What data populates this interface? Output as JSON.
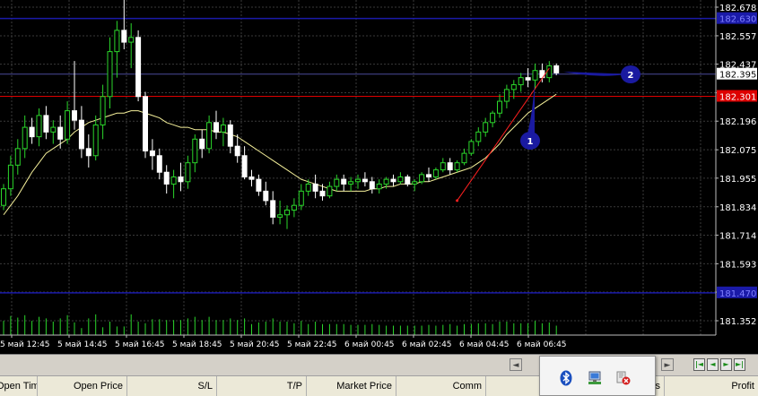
{
  "chart": {
    "price_axis": [
      "182.678",
      "182.557",
      "182.437",
      "182.316",
      "182.196",
      "182.075",
      "181.955",
      "181.834",
      "181.714",
      "181.593",
      "181.473",
      "181.352"
    ],
    "current_price": "182.395",
    "red_line_price": "182.301",
    "blue_top_price": "182.630",
    "blue_bottom_price": "181.470",
    "time_axis": [
      "5 май 12:45",
      "5 май 14:45",
      "5 май 16:45",
      "5 май 18:45",
      "5 май 20:45",
      "5 май 22:45",
      "6 май 00:45",
      "6 май 02:45",
      "6 май 04:45",
      "6 май 06:45"
    ],
    "callouts": [
      "1",
      "2"
    ],
    "colors": {
      "bull": "#2bd62b",
      "bear": "#ffffff",
      "ma": "#f5f09a",
      "grid": "#3a3a3a",
      "red_line": "#dd0000",
      "blue_line": "#1a1aa8",
      "trend_line": "#ff2020",
      "callout": "#1a1aa0"
    }
  },
  "chart_data": {
    "type": "candlestick",
    "title": "",
    "ylim": [
      181.3,
      182.74
    ],
    "candles": [
      {
        "o": 181.84,
        "h": 181.93,
        "l": 181.82,
        "c": 181.91
      },
      {
        "o": 181.91,
        "h": 182.05,
        "l": 181.88,
        "c": 182.01
      },
      {
        "o": 182.01,
        "h": 182.12,
        "l": 181.97,
        "c": 182.08
      },
      {
        "o": 182.08,
        "h": 182.22,
        "l": 182.04,
        "c": 182.17
      },
      {
        "o": 182.17,
        "h": 182.21,
        "l": 182.1,
        "c": 182.13
      },
      {
        "o": 182.13,
        "h": 182.25,
        "l": 182.09,
        "c": 182.22
      },
      {
        "o": 182.22,
        "h": 182.26,
        "l": 182.12,
        "c": 182.15
      },
      {
        "o": 182.15,
        "h": 182.2,
        "l": 182.1,
        "c": 182.17
      },
      {
        "o": 182.17,
        "h": 182.22,
        "l": 182.08,
        "c": 182.12
      },
      {
        "o": 182.12,
        "h": 182.28,
        "l": 182.1,
        "c": 182.24
      },
      {
        "o": 182.24,
        "h": 182.45,
        "l": 182.16,
        "c": 182.2
      },
      {
        "o": 182.2,
        "h": 182.26,
        "l": 182.04,
        "c": 182.08
      },
      {
        "o": 182.08,
        "h": 182.14,
        "l": 182.0,
        "c": 182.05
      },
      {
        "o": 182.05,
        "h": 182.22,
        "l": 182.03,
        "c": 182.18
      },
      {
        "o": 182.18,
        "h": 182.35,
        "l": 182.12,
        "c": 182.3
      },
      {
        "o": 182.3,
        "h": 182.55,
        "l": 182.25,
        "c": 182.49
      },
      {
        "o": 182.49,
        "h": 182.62,
        "l": 182.38,
        "c": 182.58
      },
      {
        "o": 182.58,
        "h": 182.74,
        "l": 182.5,
        "c": 182.53
      },
      {
        "o": 182.53,
        "h": 182.61,
        "l": 182.42,
        "c": 182.55
      },
      {
        "o": 182.55,
        "h": 182.58,
        "l": 182.28,
        "c": 182.3
      },
      {
        "o": 182.3,
        "h": 182.32,
        "l": 182.04,
        "c": 182.07
      },
      {
        "o": 182.07,
        "h": 182.12,
        "l": 181.99,
        "c": 182.05
      },
      {
        "o": 182.05,
        "h": 182.08,
        "l": 181.95,
        "c": 181.98
      },
      {
        "o": 181.98,
        "h": 182.01,
        "l": 181.89,
        "c": 181.93
      },
      {
        "o": 181.93,
        "h": 181.99,
        "l": 181.87,
        "c": 181.96
      },
      {
        "o": 181.96,
        "h": 182.02,
        "l": 181.9,
        "c": 181.94
      },
      {
        "o": 181.94,
        "h": 182.05,
        "l": 181.91,
        "c": 182.02
      },
      {
        "o": 182.02,
        "h": 182.14,
        "l": 181.98,
        "c": 182.12
      },
      {
        "o": 182.12,
        "h": 182.16,
        "l": 182.04,
        "c": 182.08
      },
      {
        "o": 182.08,
        "h": 182.22,
        "l": 182.06,
        "c": 182.19
      },
      {
        "o": 182.19,
        "h": 182.24,
        "l": 182.12,
        "c": 182.15
      },
      {
        "o": 182.15,
        "h": 182.21,
        "l": 182.09,
        "c": 182.18
      },
      {
        "o": 182.18,
        "h": 182.2,
        "l": 182.06,
        "c": 182.09
      },
      {
        "o": 182.09,
        "h": 182.14,
        "l": 182.02,
        "c": 182.05
      },
      {
        "o": 182.05,
        "h": 182.09,
        "l": 181.95,
        "c": 181.96
      },
      {
        "o": 181.96,
        "h": 181.99,
        "l": 181.92,
        "c": 181.95
      },
      {
        "o": 181.95,
        "h": 181.97,
        "l": 181.88,
        "c": 181.9
      },
      {
        "o": 181.9,
        "h": 181.94,
        "l": 181.84,
        "c": 181.86
      },
      {
        "o": 181.86,
        "h": 181.9,
        "l": 181.76,
        "c": 181.79
      },
      {
        "o": 181.79,
        "h": 181.86,
        "l": 181.76,
        "c": 181.8
      },
      {
        "o": 181.8,
        "h": 181.84,
        "l": 181.74,
        "c": 181.82
      },
      {
        "o": 181.82,
        "h": 181.87,
        "l": 181.79,
        "c": 181.84
      },
      {
        "o": 181.84,
        "h": 181.93,
        "l": 181.82,
        "c": 181.9
      },
      {
        "o": 181.9,
        "h": 181.95,
        "l": 181.88,
        "c": 181.93
      },
      {
        "o": 181.93,
        "h": 181.97,
        "l": 181.87,
        "c": 181.9
      },
      {
        "o": 181.9,
        "h": 181.93,
        "l": 181.86,
        "c": 181.88
      },
      {
        "o": 181.88,
        "h": 181.94,
        "l": 181.87,
        "c": 181.92
      },
      {
        "o": 181.92,
        "h": 181.97,
        "l": 181.9,
        "c": 181.95
      },
      {
        "o": 181.95,
        "h": 181.97,
        "l": 181.9,
        "c": 181.93
      },
      {
        "o": 181.93,
        "h": 181.96,
        "l": 181.9,
        "c": 181.94
      },
      {
        "o": 181.94,
        "h": 181.97,
        "l": 181.91,
        "c": 181.95
      },
      {
        "o": 181.95,
        "h": 181.98,
        "l": 181.92,
        "c": 181.94
      },
      {
        "o": 181.94,
        "h": 181.96,
        "l": 181.89,
        "c": 181.91
      },
      {
        "o": 181.91,
        "h": 181.95,
        "l": 181.89,
        "c": 181.93
      },
      {
        "o": 181.93,
        "h": 181.96,
        "l": 181.91,
        "c": 181.95
      },
      {
        "o": 181.95,
        "h": 181.97,
        "l": 181.92,
        "c": 181.94
      },
      {
        "o": 181.94,
        "h": 181.98,
        "l": 181.93,
        "c": 181.96
      },
      {
        "o": 181.96,
        "h": 181.97,
        "l": 181.92,
        "c": 181.93
      },
      {
        "o": 181.93,
        "h": 181.95,
        "l": 181.9,
        "c": 181.94
      },
      {
        "o": 181.94,
        "h": 181.98,
        "l": 181.93,
        "c": 181.97
      },
      {
        "o": 181.97,
        "h": 182.0,
        "l": 181.94,
        "c": 181.96
      },
      {
        "o": 181.96,
        "h": 182.0,
        "l": 181.95,
        "c": 181.99
      },
      {
        "o": 181.99,
        "h": 182.04,
        "l": 181.98,
        "c": 182.02
      },
      {
        "o": 182.02,
        "h": 182.04,
        "l": 181.97,
        "c": 181.99
      },
      {
        "o": 181.99,
        "h": 182.03,
        "l": 181.98,
        "c": 182.02
      },
      {
        "o": 182.02,
        "h": 182.08,
        "l": 182.01,
        "c": 182.06
      },
      {
        "o": 182.06,
        "h": 182.12,
        "l": 182.05,
        "c": 182.11
      },
      {
        "o": 182.11,
        "h": 182.17,
        "l": 182.09,
        "c": 182.15
      },
      {
        "o": 182.15,
        "h": 182.21,
        "l": 182.13,
        "c": 182.19
      },
      {
        "o": 182.19,
        "h": 182.24,
        "l": 182.17,
        "c": 182.23
      },
      {
        "o": 182.23,
        "h": 182.31,
        "l": 182.21,
        "c": 182.28
      },
      {
        "o": 182.28,
        "h": 182.35,
        "l": 182.25,
        "c": 182.33
      },
      {
        "o": 182.33,
        "h": 182.37,
        "l": 182.29,
        "c": 182.35
      },
      {
        "o": 182.35,
        "h": 182.4,
        "l": 182.32,
        "c": 182.38
      },
      {
        "o": 182.38,
        "h": 182.42,
        "l": 182.34,
        "c": 182.37
      },
      {
        "o": 182.37,
        "h": 182.44,
        "l": 182.33,
        "c": 182.41
      },
      {
        "o": 182.41,
        "h": 182.44,
        "l": 182.36,
        "c": 182.38
      },
      {
        "o": 182.38,
        "h": 182.45,
        "l": 182.36,
        "c": 182.43
      },
      {
        "o": 182.43,
        "h": 182.44,
        "l": 182.39,
        "c": 182.4
      }
    ],
    "moving_average": [
      181.8,
      181.84,
      181.88,
      181.93,
      181.98,
      182.02,
      182.06,
      182.08,
      182.1,
      182.12,
      182.15,
      182.17,
      182.19,
      182.2,
      182.21,
      182.22,
      182.23,
      182.23,
      182.24,
      182.24,
      182.23,
      182.22,
      182.21,
      182.19,
      182.18,
      182.17,
      182.17,
      182.16,
      182.16,
      182.16,
      182.15,
      182.15,
      182.14,
      182.13,
      182.11,
      182.09,
      182.07,
      182.05,
      182.03,
      182.01,
      181.99,
      181.97,
      181.95,
      181.94,
      181.93,
      181.92,
      181.91,
      181.9,
      181.9,
      181.9,
      181.9,
      181.9,
      181.91,
      181.91,
      181.92,
      181.92,
      181.93,
      181.93,
      181.93,
      181.94,
      181.94,
      181.95,
      181.96,
      181.97,
      181.98,
      181.99,
      182.0,
      182.02,
      182.04,
      182.07,
      182.1,
      182.14,
      182.17,
      182.2,
      182.23,
      182.25,
      182.27,
      182.29,
      182.31
    ],
    "trend_line": {
      "from_index": 64,
      "from_price": 181.86,
      "to_index": 77,
      "to_price": 182.42
    }
  },
  "toolbar": {
    "scroll_left": "◄",
    "scroll_right": "►",
    "nav_first": "|◄",
    "nav_prev": "◄",
    "nav_next": "►",
    "nav_last": "►|"
  },
  "columns": [
    "Open Time",
    "Open Price",
    "S/L",
    "T/P",
    "Market Price",
    "Comm",
    "ts",
    "Profit"
  ],
  "tray": {
    "icons": [
      "bluetooth-icon",
      "network-icon",
      "security-alert-icon"
    ]
  }
}
